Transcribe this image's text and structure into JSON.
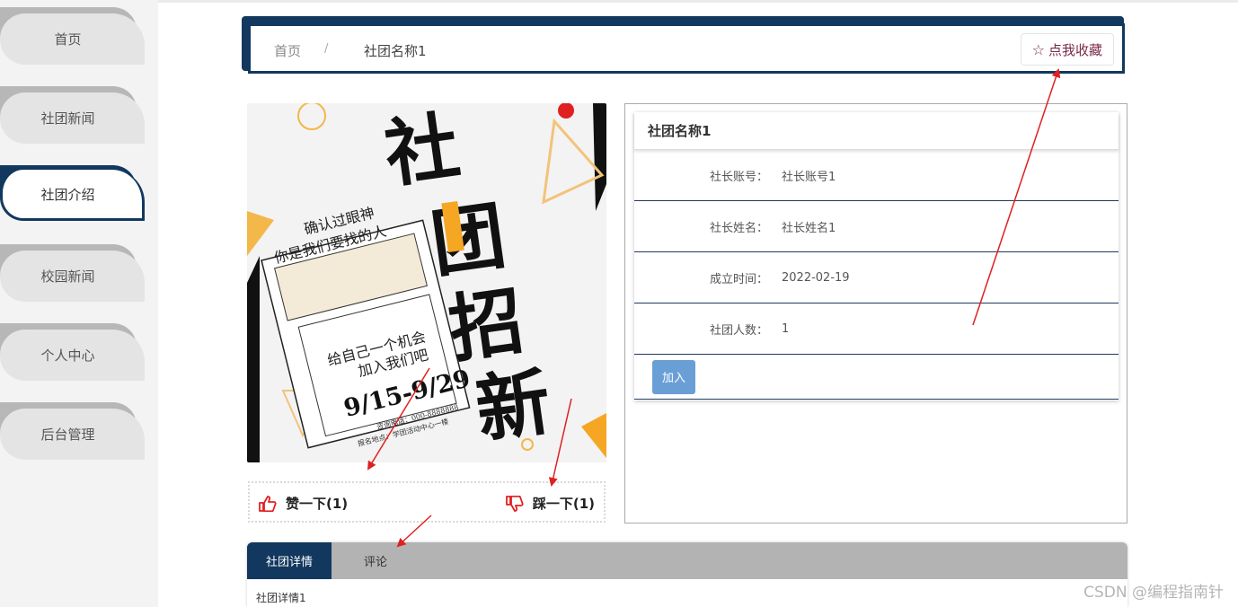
{
  "sidebar": {
    "items": [
      {
        "label": "首页"
      },
      {
        "label": "社团新闻"
      },
      {
        "label": "社团介绍"
      },
      {
        "label": "校园新闻"
      },
      {
        "label": "个人中心"
      },
      {
        "label": "后台管理"
      }
    ]
  },
  "breadcrumb": {
    "home": "首页",
    "separator": "/",
    "current": "社团名称1",
    "favorite_label": "点我收藏"
  },
  "poster": {
    "headline_chars": [
      "社",
      "团",
      "招",
      "新"
    ],
    "line1": "确认过眼神",
    "line2": "你是我们要找的人",
    "line3": "给自己一个机会",
    "line4": "加入我们吧",
    "dates": "9/15-9/29",
    "phone": "咨询电话：000-8888888",
    "location": "报名地点：学团活动中心一楼"
  },
  "vote": {
    "like_label": "赞一下(1)",
    "dislike_label": "踩一下(1)"
  },
  "info": {
    "title": "社团名称1",
    "rows": [
      {
        "label": "社长账号",
        "value": "社长账号1"
      },
      {
        "label": "社长姓名",
        "value": "社长姓名1"
      },
      {
        "label": "成立时间",
        "value": "2022-02-19"
      },
      {
        "label": "社团人数",
        "value": "1"
      }
    ],
    "colon": "：",
    "join_label": "加入"
  },
  "tabs": {
    "items": [
      {
        "label": "社团详情"
      },
      {
        "label": "评论"
      }
    ],
    "content": "社团详情1"
  },
  "watermark": "CSDN @编程指南针",
  "colors": {
    "primary": "#12385f",
    "sidebar_bg": "#f3f3f3",
    "join_button": "#6a9fd5",
    "favorite_text": "#7a2a4a",
    "annotation_arrow": "#e02020",
    "like_icon": "#e02020"
  }
}
